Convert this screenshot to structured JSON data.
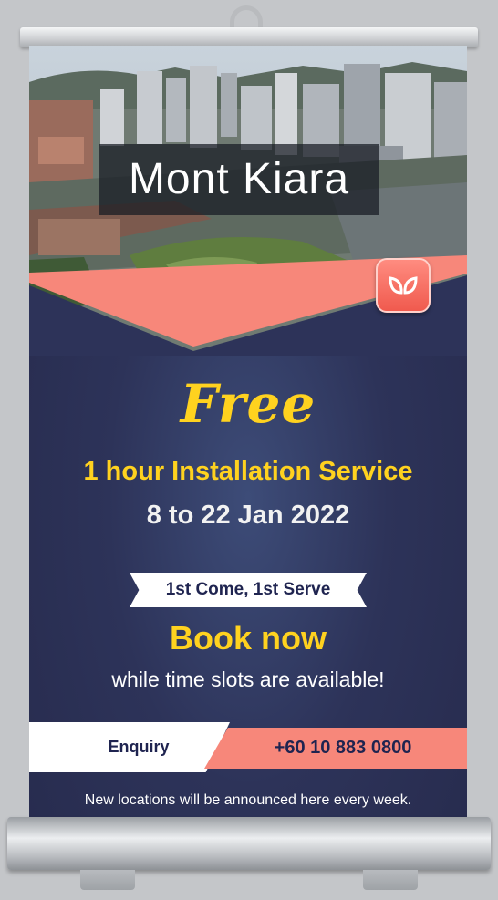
{
  "banner": {
    "location": "Mont Kiara",
    "headline": "Free",
    "service": "1 hour Installation Service",
    "dates": "8  to 22 Jan 2022",
    "ribbon": "1st Come, 1st Serve",
    "cta": "Book now",
    "cta_sub": "while time slots are available!",
    "enquiry_label": "Enquiry",
    "phone": "+60 10 883 0800",
    "footer": "New locations will be announced here every week."
  },
  "icons": [
    "hanger-hook-icon",
    "leaf-logo-icon"
  ],
  "colors": {
    "navy": "#2d3359",
    "yellow": "#ffd21f",
    "coral": "#f7877a",
    "white": "#ffffff"
  }
}
